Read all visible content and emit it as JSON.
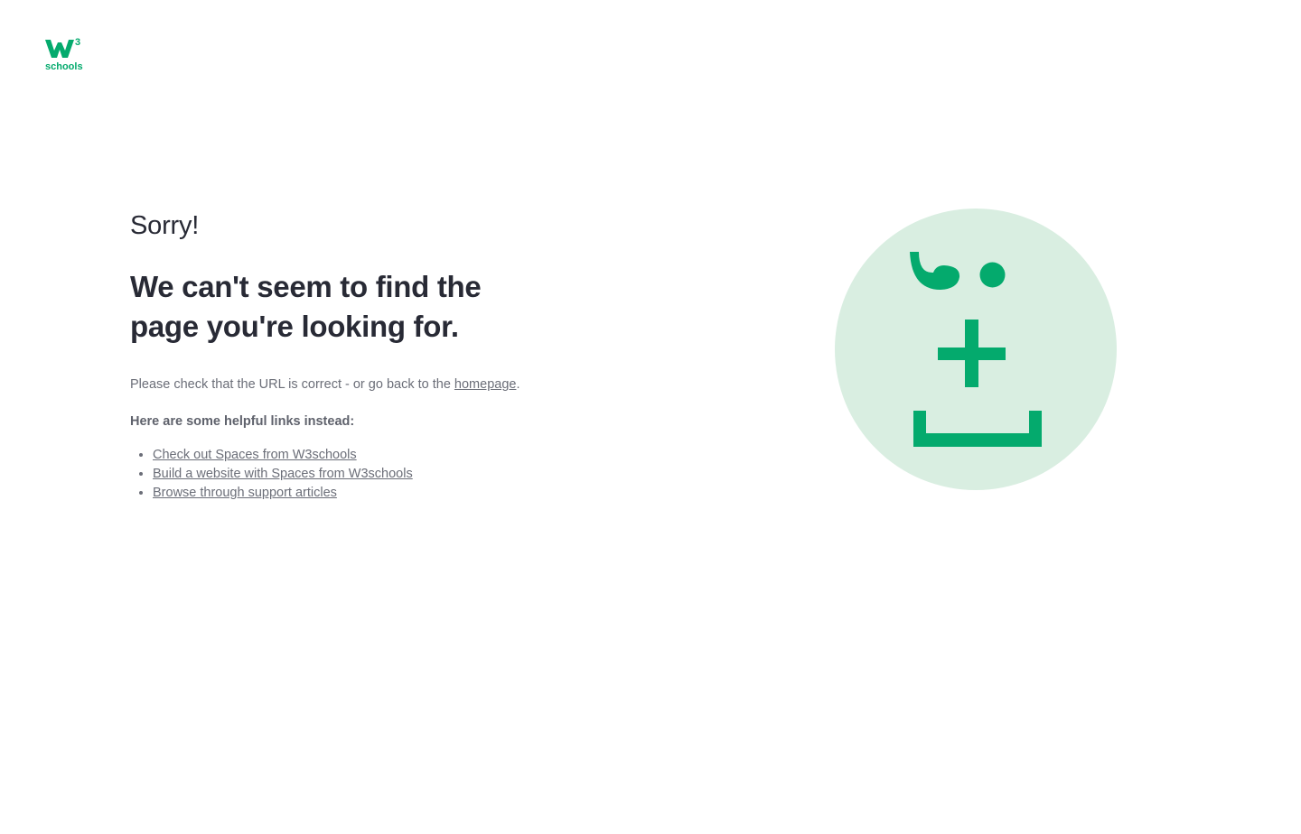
{
  "logo": {
    "superscript": "3",
    "wordmark": "schools",
    "brand_color": "#04aa6d"
  },
  "error": {
    "sorry": "Sorry!",
    "headline": "We can't seem to find the page you're looking for.",
    "message_prefix": "Please check that the URL is correct - or go back to the",
    "homepage_link": "homepage",
    "message_suffix": ".",
    "helpful_heading": "Here are some helpful links instead:",
    "links": [
      "Check out Spaces from W3schools",
      "Build a website with Spaces from W3schools",
      "Browse through support articles"
    ]
  },
  "illustration": {
    "circle_color": "#d9eee1",
    "face_color": "#04aa6d",
    "icon": "confused-face-icon"
  },
  "colors": {
    "heading_text": "#282a35",
    "body_text": "#6b6e78",
    "background": "#ffffff"
  }
}
